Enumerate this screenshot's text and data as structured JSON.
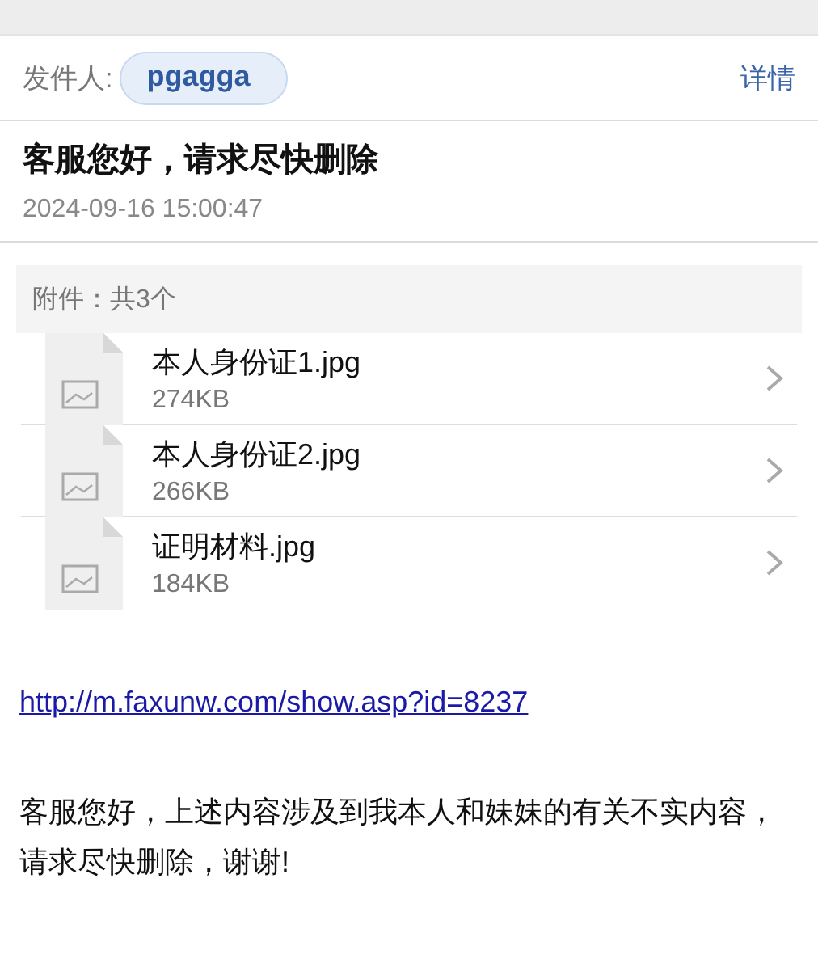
{
  "sender": {
    "label": "发件人:",
    "name": "pgagga",
    "details": "详情"
  },
  "subject": "客服您好，请求尽快删除",
  "date": "2024-09-16 15:00:47",
  "attachments": {
    "header": "附件：共3个",
    "items": [
      {
        "name": "本人身份证1.jpg",
        "size": "274KB"
      },
      {
        "name": "本人身份证2.jpg",
        "size": "266KB"
      },
      {
        "name": "证明材料.jpg",
        "size": "184KB"
      }
    ]
  },
  "body": {
    "link": "http://m.faxunw.com/show.asp?id=8237",
    "text": "客服您好，上述内容涉及到我本人和妹妹的有关不实内容，请求尽快删除，谢谢!"
  }
}
